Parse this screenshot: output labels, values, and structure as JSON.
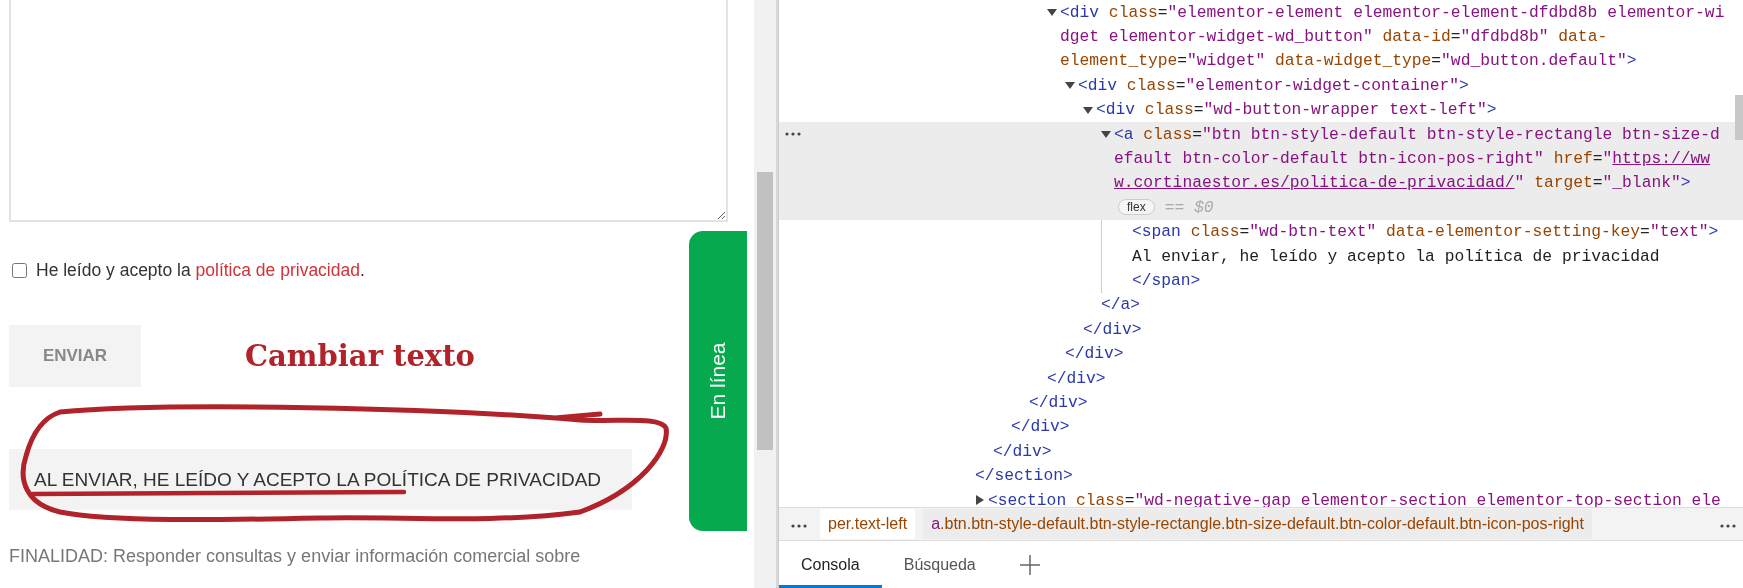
{
  "page": {
    "consent": {
      "checked": false,
      "before": "He leído y acepto la ",
      "link": "política de privacidad",
      "after": "."
    },
    "send_button": "ENVIAR",
    "annotation": "Cambiar texto",
    "privacy_button": "AL ENVIAR, HE LEÍDO Y ACEPTO LA POLÍTICA DE PRIVACIDAD",
    "purpose": "FINALIDAD: Responder consultas y enviar información comercial sobre",
    "chat_tab": "En línea"
  },
  "devtools": {
    "tree": [
      {
        "close": "</section>",
        "children": [
          {
            "close": "</div>",
            "children": [
              {
                "close": "</div>",
                "children": [
                  {
                    "close": "</div>",
                    "children": [
                      {
                        "lines": [
                          [
                            {
                              "kind": "tag",
                              "text": "<div"
                            },
                            {
                              "kind": "attr",
                              "text": " class"
                            },
                            {
                              "kind": "plain",
                              "text": "="
                            },
                            {
                              "kind": "value",
                              "text": "\"elementor-element elementor-element-dfdbd8b elementor-wi"
                            }
                          ],
                          [
                            {
                              "kind": "value",
                              "text": "dget elementor-widget-wd_button\""
                            },
                            {
                              "kind": "attr",
                              "text": " data-id"
                            },
                            {
                              "kind": "plain",
                              "text": "="
                            },
                            {
                              "kind": "value",
                              "text": "\"dfdbd8b\""
                            },
                            {
                              "kind": "attr",
                              "text": " data-"
                            }
                          ],
                          [
                            {
                              "kind": "attr",
                              "text": "element_type"
                            },
                            {
                              "kind": "plain",
                              "text": "="
                            },
                            {
                              "kind": "value",
                              "text": "\"widget\""
                            },
                            {
                              "kind": "attr",
                              "text": " data-widget_type"
                            },
                            {
                              "kind": "plain",
                              "text": "="
                            },
                            {
                              "kind": "value",
                              "text": "\"wd_button.default\""
                            },
                            {
                              "kind": "tag",
                              "text": ">"
                            }
                          ]
                        ],
                        "expanded": true,
                        "close": "</div>",
                        "children": [
                          {
                            "lines": [
                              [
                                {
                                  "kind": "tag",
                                  "text": "<div"
                                },
                                {
                                  "kind": "attr",
                                  "text": " class"
                                },
                                {
                                  "kind": "plain",
                                  "text": "="
                                },
                                {
                                  "kind": "value",
                                  "text": "\"elementor-widget-container\""
                                },
                                {
                                  "kind": "tag",
                                  "text": ">"
                                }
                              ]
                            ],
                            "expanded": true,
                            "close": "</div>",
                            "children": [
                              {
                                "lines": [
                                  [
                                    {
                                      "kind": "tag",
                                      "text": "<div"
                                    },
                                    {
                                      "kind": "attr",
                                      "text": " class"
                                    },
                                    {
                                      "kind": "plain",
                                      "text": "="
                                    },
                                    {
                                      "kind": "value",
                                      "text": "\"wd-button-wrapper text-left\""
                                    },
                                    {
                                      "kind": "tag",
                                      "text": ">"
                                    }
                                  ]
                                ],
                                "expanded": true,
                                "close": "</div>",
                                "children": [
                                  {
                                    "selected": true,
                                    "expanded": true,
                                    "badge": "flex",
                                    "note": "== $0",
                                    "lines": [
                                      [
                                        {
                                          "kind": "tag",
                                          "text": "<a"
                                        },
                                        {
                                          "kind": "attr",
                                          "text": " class"
                                        },
                                        {
                                          "kind": "plain",
                                          "text": "="
                                        },
                                        {
                                          "kind": "value",
                                          "text": "\"btn btn-style-default btn-style-rectangle btn-size-d"
                                        }
                                      ],
                                      [
                                        {
                                          "kind": "value",
                                          "text": "efault btn-color-default btn-icon-pos-right\""
                                        },
                                        {
                                          "kind": "attr",
                                          "text": " href"
                                        },
                                        {
                                          "kind": "plain",
                                          "text": "="
                                        },
                                        {
                                          "kind": "value",
                                          "text": "\""
                                        },
                                        {
                                          "kind": "link",
                                          "text": "https://ww"
                                        }
                                      ],
                                      [
                                        {
                                          "kind": "link",
                                          "text": "w.cortinaestor.es/politica-de-privacidad/"
                                        },
                                        {
                                          "kind": "value",
                                          "text": "\""
                                        },
                                        {
                                          "kind": "attr",
                                          "text": " target"
                                        },
                                        {
                                          "kind": "plain",
                                          "text": "="
                                        },
                                        {
                                          "kind": "value",
                                          "text": "\"_blank\""
                                        },
                                        {
                                          "kind": "tag",
                                          "text": ">"
                                        }
                                      ]
                                    ],
                                    "close": "</a>",
                                    "children": [
                                      {
                                        "lines": [
                                          [
                                            {
                                              "kind": "tag",
                                              "text": "<span"
                                            },
                                            {
                                              "kind": "attr",
                                              "text": " class"
                                            },
                                            {
                                              "kind": "plain",
                                              "text": "="
                                            },
                                            {
                                              "kind": "value",
                                              "text": "\"wd-btn-text\""
                                            },
                                            {
                                              "kind": "attr",
                                              "text": " data-elementor-setting-key"
                                            },
                                            {
                                              "kind": "plain",
                                              "text": "="
                                            },
                                            {
                                              "kind": "value",
                                              "text": "\"text\""
                                            },
                                            {
                                              "kind": "tag",
                                              "text": ">"
                                            }
                                          ]
                                        ],
                                        "text": "Al enviar, he leído y acepto la política de privacidad",
                                        "close": "</span>"
                                      }
                                    ]
                                  }
                                ]
                              }
                            ]
                          }
                        ]
                      }
                    ]
                  }
                ]
              }
            ]
          }
        ]
      },
      {
        "expanded": false,
        "lines": [
          [
            {
              "kind": "tag",
              "text": "<section"
            },
            {
              "kind": "attr",
              "text": " class"
            },
            {
              "kind": "plain",
              "text": "="
            },
            {
              "kind": "value",
              "text": "\"wd-negative-gap elementor-section elementor-top-section ele"
            }
          ]
        ]
      }
    ],
    "breadcrumbs": [
      {
        "selected": false,
        "parts": [
          {
            "kind": "attr",
            "text": "per.text-left"
          }
        ]
      },
      {
        "selected": true,
        "parts": [
          {
            "kind": "value",
            "text": "a"
          },
          {
            "kind": "attr",
            "text": ".btn.btn-style-default.btn-style-rectangle.btn-size-default.btn-color-default.btn-icon-pos-right"
          }
        ]
      }
    ],
    "drawer_tabs": [
      {
        "label": "Consola",
        "selected": true
      },
      {
        "label": "Búsqueda",
        "selected": false
      }
    ]
  }
}
